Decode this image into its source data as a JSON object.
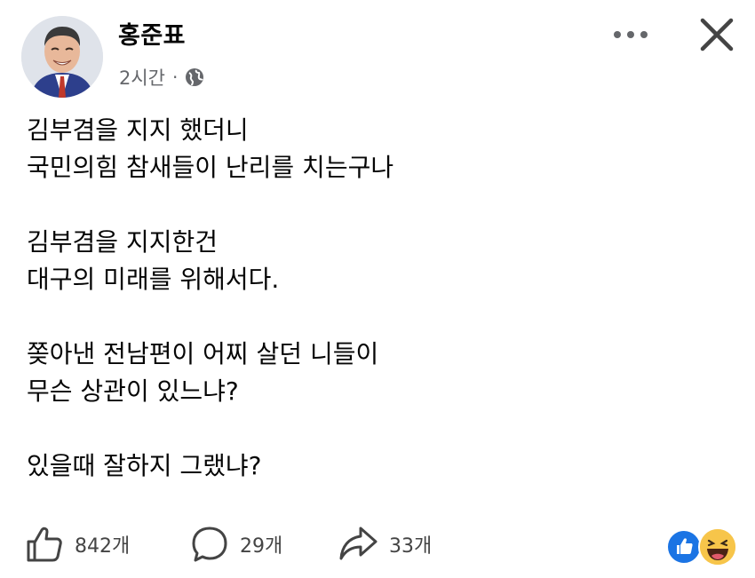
{
  "post": {
    "author": "홍준표",
    "time": "2시간",
    "separator": "·",
    "privacy_icon": "globe-icon"
  },
  "body": {
    "paragraphs": [
      [
        "김부겸을 지지 했더니",
        "국민의힘 참새들이 난리를 치는구나"
      ],
      [
        "김부겸을 지지한건",
        "대구의 미래를 위해서다."
      ],
      [
        "쫒아낸 전남편이 어찌 살던 니들이",
        "무슨 상관이 있느냐?"
      ],
      [
        "있을때 잘하지 그랬냐?"
      ]
    ]
  },
  "footer": {
    "likes": "842개",
    "comments": "29개",
    "shares": "33개"
  },
  "reactions": [
    "like-icon",
    "haha-icon"
  ],
  "colors": {
    "text": "#050505",
    "secondary": "#65676b",
    "like_blue": "#1b74e4",
    "haha_yellow": "#f7c54a"
  }
}
